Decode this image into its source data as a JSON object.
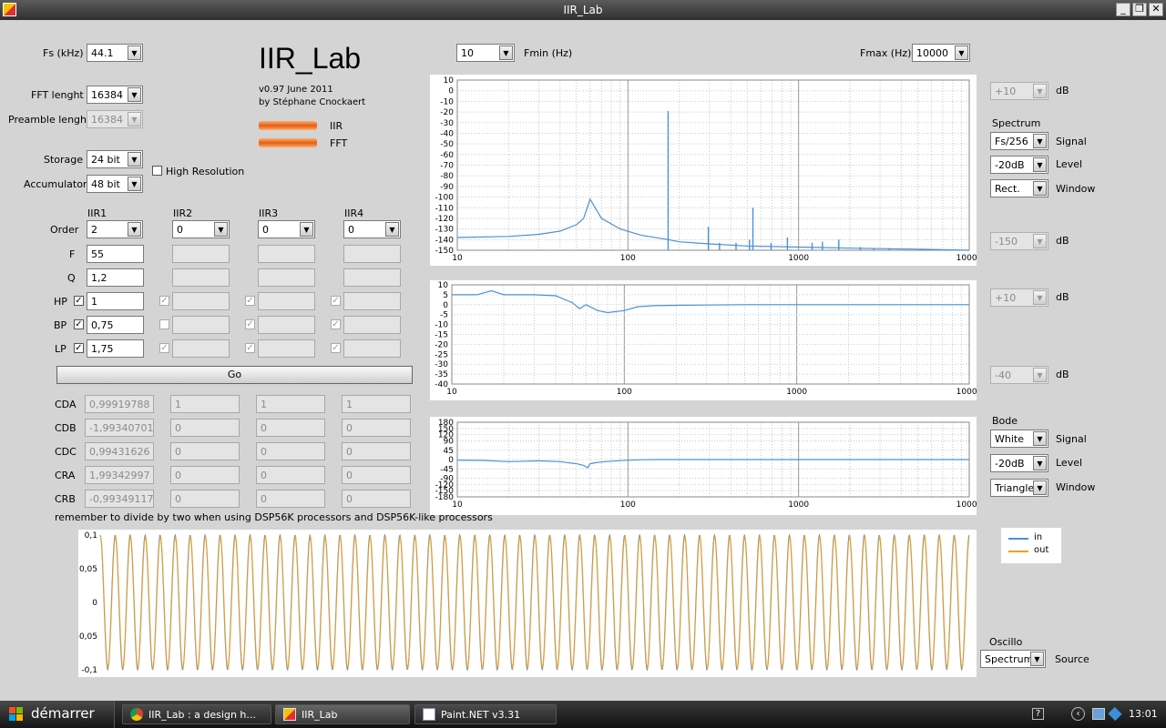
{
  "window": {
    "title": "IIR_Lab"
  },
  "app": {
    "title": "IIR_Lab",
    "version": "v0.97 June 2011",
    "author": "by Stéphane Cnockaert",
    "ind_iir": "IIR",
    "ind_fft": "FFT"
  },
  "settings": {
    "fs_label": "Fs (kHz)",
    "fs": "44.1",
    "fft_label": "FFT lenght",
    "fft": "16384",
    "pre_label": "Preamble lenght",
    "pre": "16384",
    "storage_label": "Storage",
    "storage": "24 bit",
    "acc_label": "Accumulator",
    "acc": "48 bit",
    "highres_label": "High Resolution"
  },
  "iir": {
    "headers": [
      "IIR1",
      "IIR2",
      "IIR3",
      "IIR4"
    ],
    "order_label": "Order",
    "f_label": "F",
    "q_label": "Q",
    "hp_label": "HP",
    "bp_label": "BP",
    "lp_label": "LP",
    "orders": [
      "2",
      "0",
      "0",
      "0"
    ],
    "f1": "55",
    "q1": "1,2",
    "hp1": "1",
    "bp1": "0,75",
    "lp1": "1,75",
    "go": "Go"
  },
  "coeffs": {
    "labels": [
      "CDA",
      "CDB",
      "CDC",
      "CRA",
      "CRB"
    ],
    "rows": [
      [
        "0,99919788",
        "1",
        "1",
        "1"
      ],
      [
        "-1,99340701",
        "0",
        "0",
        "0"
      ],
      [
        "0,99431626",
        "0",
        "0",
        "0"
      ],
      [
        "1,99342997",
        "0",
        "0",
        "0"
      ],
      [
        "-0,99349117",
        "0",
        "0",
        "0"
      ]
    ],
    "note": "remember to divide by two when using DSP56K processors and DSP56K-like processors"
  },
  "freq": {
    "fmin_label": "Fmin (Hz)",
    "fmin": "10",
    "fmax_label": "Fmax (Hz)",
    "fmax": "10000"
  },
  "right": {
    "db": "dB",
    "spec_top": "+10",
    "spec_bottom": "-150",
    "spectrum_title": "Spectrum",
    "spec_signal": "Fs/256",
    "signal_label": "Signal",
    "spec_level": "-20dB",
    "level_label": "Level",
    "spec_window": "Rect.",
    "window_label": "Window",
    "mag_top": "+10",
    "mag_bottom": "-40",
    "bode_title": "Bode",
    "bode_signal": "White",
    "bode_level": "-20dB",
    "bode_window": "Triangle",
    "oscillo_title": "Oscillo",
    "osc_source": "Spectrum",
    "source_label": "Source",
    "legend_in": "in",
    "legend_out": "out"
  },
  "colors": {
    "in": "#4a90d9",
    "out": "#f0a020",
    "grid": "#c8c8c8"
  },
  "taskbar": {
    "start": "démarrer",
    "items": [
      "IIR_Lab : a design h...",
      "IIR_Lab",
      "Paint.NET v3.31"
    ],
    "clock": "13:01"
  },
  "chart_data": [
    {
      "type": "line",
      "name": "spectrum",
      "xscale": "log",
      "xlim": [
        10,
        10000
      ],
      "ylim": [
        -150,
        10
      ],
      "xticks": [
        "10",
        "100",
        "1000",
        "10000"
      ],
      "yticks": [
        "10",
        "0",
        "-10",
        "-20",
        "-30",
        "-40",
        "-50",
        "-60",
        "-70",
        "-80",
        "-90",
        "-100",
        "-110",
        "-120",
        "-130",
        "-140",
        "-150"
      ],
      "series": [
        {
          "x": [
            10,
            20,
            30,
            40,
            50,
            55,
            60,
            70,
            90,
            120,
            172,
            200,
            300,
            500,
            1000,
            2000,
            5000,
            10000
          ],
          "y": [
            -138,
            -137,
            -135,
            -132,
            -126,
            -120,
            -102,
            -120,
            -130,
            -136,
            -140,
            -142,
            -144,
            -146,
            -147,
            -148,
            -149,
            -150
          ]
        }
      ],
      "peaks": [
        {
          "x": 172,
          "y": -19
        },
        {
          "x": 296,
          "y": -128
        },
        {
          "x": 344,
          "y": -143
        },
        {
          "x": 430,
          "y": -143
        },
        {
          "x": 516,
          "y": -140
        },
        {
          "x": 540,
          "y": -110
        },
        {
          "x": 690,
          "y": -143
        },
        {
          "x": 860,
          "y": -138
        },
        {
          "x": 1200,
          "y": -143
        },
        {
          "x": 1380,
          "y": -142
        },
        {
          "x": 1720,
          "y": -140
        },
        {
          "x": 2300,
          "y": -147
        },
        {
          "x": 2750,
          "y": -148
        },
        {
          "x": 3400,
          "y": -148
        }
      ]
    },
    {
      "type": "line",
      "name": "magnitude",
      "xscale": "log",
      "xlim": [
        10,
        10000
      ],
      "ylim": [
        -40,
        10
      ],
      "xticks": [
        "10",
        "100",
        "1000",
        "10000"
      ],
      "yticks": [
        "10",
        "5",
        "0",
        "-5",
        "-10",
        "-15",
        "-20",
        "-25",
        "-30",
        "-35",
        "-40"
      ],
      "series": [
        {
          "x": [
            10,
            14,
            17,
            20,
            25,
            30,
            40,
            50,
            55,
            60,
            70,
            80,
            100,
            120,
            150,
            200,
            300,
            500,
            1000,
            2000,
            10000
          ],
          "y": [
            5,
            5,
            7,
            5,
            5,
            5,
            4.5,
            1,
            -2,
            0,
            -3,
            -4,
            -3,
            -1,
            -0.5,
            -0.3,
            -0.2,
            0,
            0,
            0,
            0
          ]
        }
      ]
    },
    {
      "type": "line",
      "name": "phase",
      "xscale": "log",
      "xlim": [
        10,
        10000
      ],
      "ylim": [
        -180,
        180
      ],
      "xticks": [
        "10",
        "100",
        "1000",
        "10000"
      ],
      "yticks": [
        "180",
        "150",
        "120",
        "90",
        "45",
        "0",
        "-45",
        "-90",
        "-120",
        "-150",
        "-180"
      ],
      "series": [
        {
          "x": [
            10,
            14,
            20,
            25,
            30,
            40,
            50,
            55,
            58,
            60,
            65,
            70,
            80,
            100,
            120,
            150,
            200,
            1000,
            10000
          ],
          "y": [
            -3,
            -4,
            -10,
            -8,
            -6,
            -10,
            -20,
            -28,
            -40,
            -20,
            -15,
            -12,
            -8,
            -3,
            -1,
            0,
            0,
            0,
            0
          ]
        }
      ]
    },
    {
      "type": "line",
      "name": "oscillo",
      "ylim": [
        -0.1,
        0.1
      ],
      "yticks": [
        "0,1",
        "0,05",
        "0",
        "-0,05",
        "-0,1"
      ],
      "cycles": 58,
      "amplitude": 0.1,
      "series": [
        {
          "name": "in"
        },
        {
          "name": "out"
        }
      ]
    }
  ]
}
